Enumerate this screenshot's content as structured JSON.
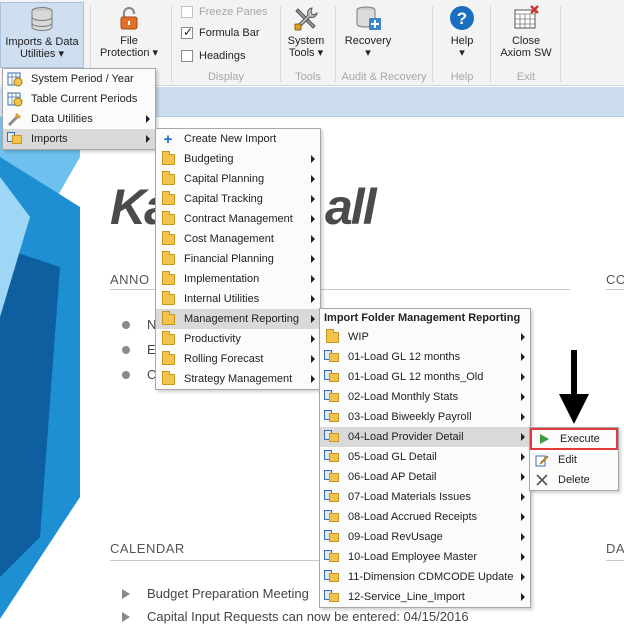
{
  "ribbon": {
    "imports_data_utilities": {
      "line1": "Imports & Data",
      "line2": "Utilities",
      "arrow": "▾"
    },
    "file_protection": {
      "line1": "File",
      "line2": "Protection",
      "arrow": "▾"
    },
    "freeze_panes": "Freeze Panes",
    "formula_bar": "Formula Bar",
    "headings": "Headings",
    "display_group": "Display",
    "system_tools": {
      "line1": "System",
      "line2": "Tools",
      "arrow": "▾"
    },
    "tools_group": "Tools",
    "recovery": {
      "line1": "Recovery",
      "arrow": "▾"
    },
    "audit_group": "Audit & Recovery",
    "help": {
      "line1": "Help",
      "arrow": "▾"
    },
    "help_group": "Help",
    "close": {
      "line1": "Close",
      "line2": "Axiom SW"
    },
    "exit_group": "Exit"
  },
  "page": {
    "logo_left": "Ka",
    "logo_right": "all",
    "announcements_heading": "ANNO",
    "right_heading_1": "CO",
    "bullets": [
      "N",
      "E",
      "C"
    ],
    "calendar_heading": "CALENDAR",
    "right_heading_2": "DA",
    "calendar_items": [
      "Budget Preparation Meeting",
      "Capital Input Requests can now be entered: 04/15/2016"
    ]
  },
  "menu1": {
    "items": [
      {
        "label": "System Period / Year",
        "icon": "period-icon"
      },
      {
        "label": "Table Current Periods",
        "icon": "table-periods-icon"
      },
      {
        "label": "Data Utilities",
        "icon": "data-utilities-icon"
      },
      {
        "label": "Imports",
        "icon": "imports-icon"
      }
    ]
  },
  "menu2": {
    "items": [
      {
        "label": "Create New Import",
        "icon": "plus-icon"
      },
      {
        "label": "Budgeting"
      },
      {
        "label": "Capital Planning"
      },
      {
        "label": "Capital Tracking"
      },
      {
        "label": "Contract Management"
      },
      {
        "label": "Cost Management"
      },
      {
        "label": "Financial Planning"
      },
      {
        "label": "Implementation"
      },
      {
        "label": "Internal Utilities"
      },
      {
        "label": "Management Reporting"
      },
      {
        "label": "Productivity"
      },
      {
        "label": "Rolling Forecast"
      },
      {
        "label": "Strategy Management"
      }
    ]
  },
  "menu3": {
    "header": "Import Folder Management Reporting",
    "items": [
      {
        "label": "WIP",
        "icon": "folder-icon"
      },
      {
        "label": "01-Load GL 12 months"
      },
      {
        "label": "01-Load GL 12 months_Old"
      },
      {
        "label": "02-Load Monthly Stats"
      },
      {
        "label": "03-Load Biweekly Payroll"
      },
      {
        "label": "04-Load Provider Detail"
      },
      {
        "label": "05-Load GL Detail"
      },
      {
        "label": "06-Load AP Detail"
      },
      {
        "label": "07-Load Materials Issues"
      },
      {
        "label": "08-Load Accrued Receipts"
      },
      {
        "label": "09-Load RevUsage"
      },
      {
        "label": "10-Load Employee Master"
      },
      {
        "label": "11-Dimension CDMCODE Update"
      },
      {
        "label": "12-Service_Line_Import"
      }
    ]
  },
  "menu4": {
    "items": [
      {
        "label": "Execute",
        "icon": "play-icon"
      },
      {
        "label": "Edit",
        "icon": "edit-icon"
      },
      {
        "label": "Delete",
        "icon": "delete-icon"
      }
    ]
  },
  "colors": {
    "accent_blue": "#1a7fc4",
    "highlight_red": "#e03b3b",
    "menu_hover": "#d9d9d9"
  }
}
